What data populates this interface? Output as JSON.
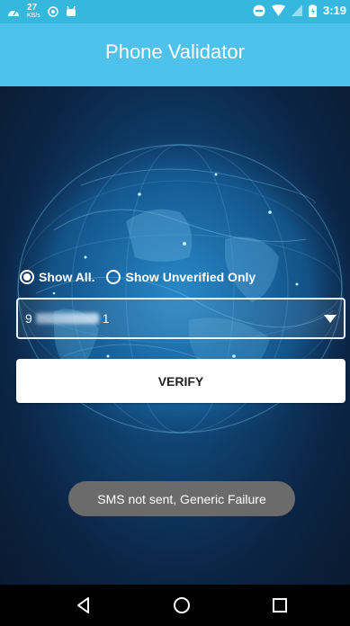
{
  "status_bar": {
    "net_speed": "27",
    "net_unit": "KB/s",
    "time": "3:19"
  },
  "app_bar": {
    "title": "Phone Validator"
  },
  "filter": {
    "options": [
      {
        "label": "Show All.",
        "selected": true
      },
      {
        "label": "Show Unverified Only",
        "selected": false
      }
    ]
  },
  "phone_select": {
    "value_start": "9",
    "value_end": "1"
  },
  "verify_button": {
    "label": "VERIFY"
  },
  "toast": {
    "message": "SMS not sent, Generic Failure"
  },
  "nav": {
    "back": "back-icon",
    "home": "home-icon",
    "recents": "recents-icon"
  },
  "colors": {
    "status_bar": "#36b7dd",
    "app_bar": "#4ec2eb",
    "background": "#0f3e6b",
    "toast": "#6b6b6b"
  }
}
